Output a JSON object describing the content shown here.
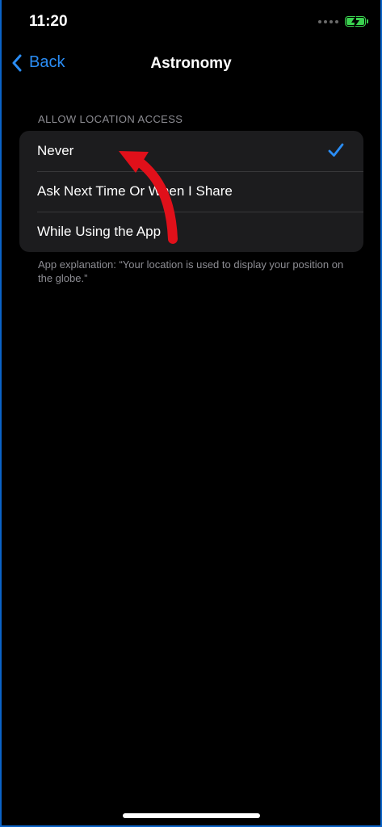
{
  "status_bar": {
    "time": "11:20"
  },
  "nav": {
    "back_label": "Back",
    "title": "Astronomy"
  },
  "section": {
    "header": "ALLOW LOCATION ACCESS",
    "options": [
      {
        "label": "Never",
        "selected": true
      },
      {
        "label": "Ask Next Time Or When I Share",
        "selected": false
      },
      {
        "label": "While Using the App",
        "selected": false
      }
    ],
    "footer": "App explanation: “Your location is used to display your position on the globe.”"
  },
  "colors": {
    "accent": "#2a8df5",
    "annotation_arrow": "#e0101a",
    "battery": "#3ad14f"
  }
}
